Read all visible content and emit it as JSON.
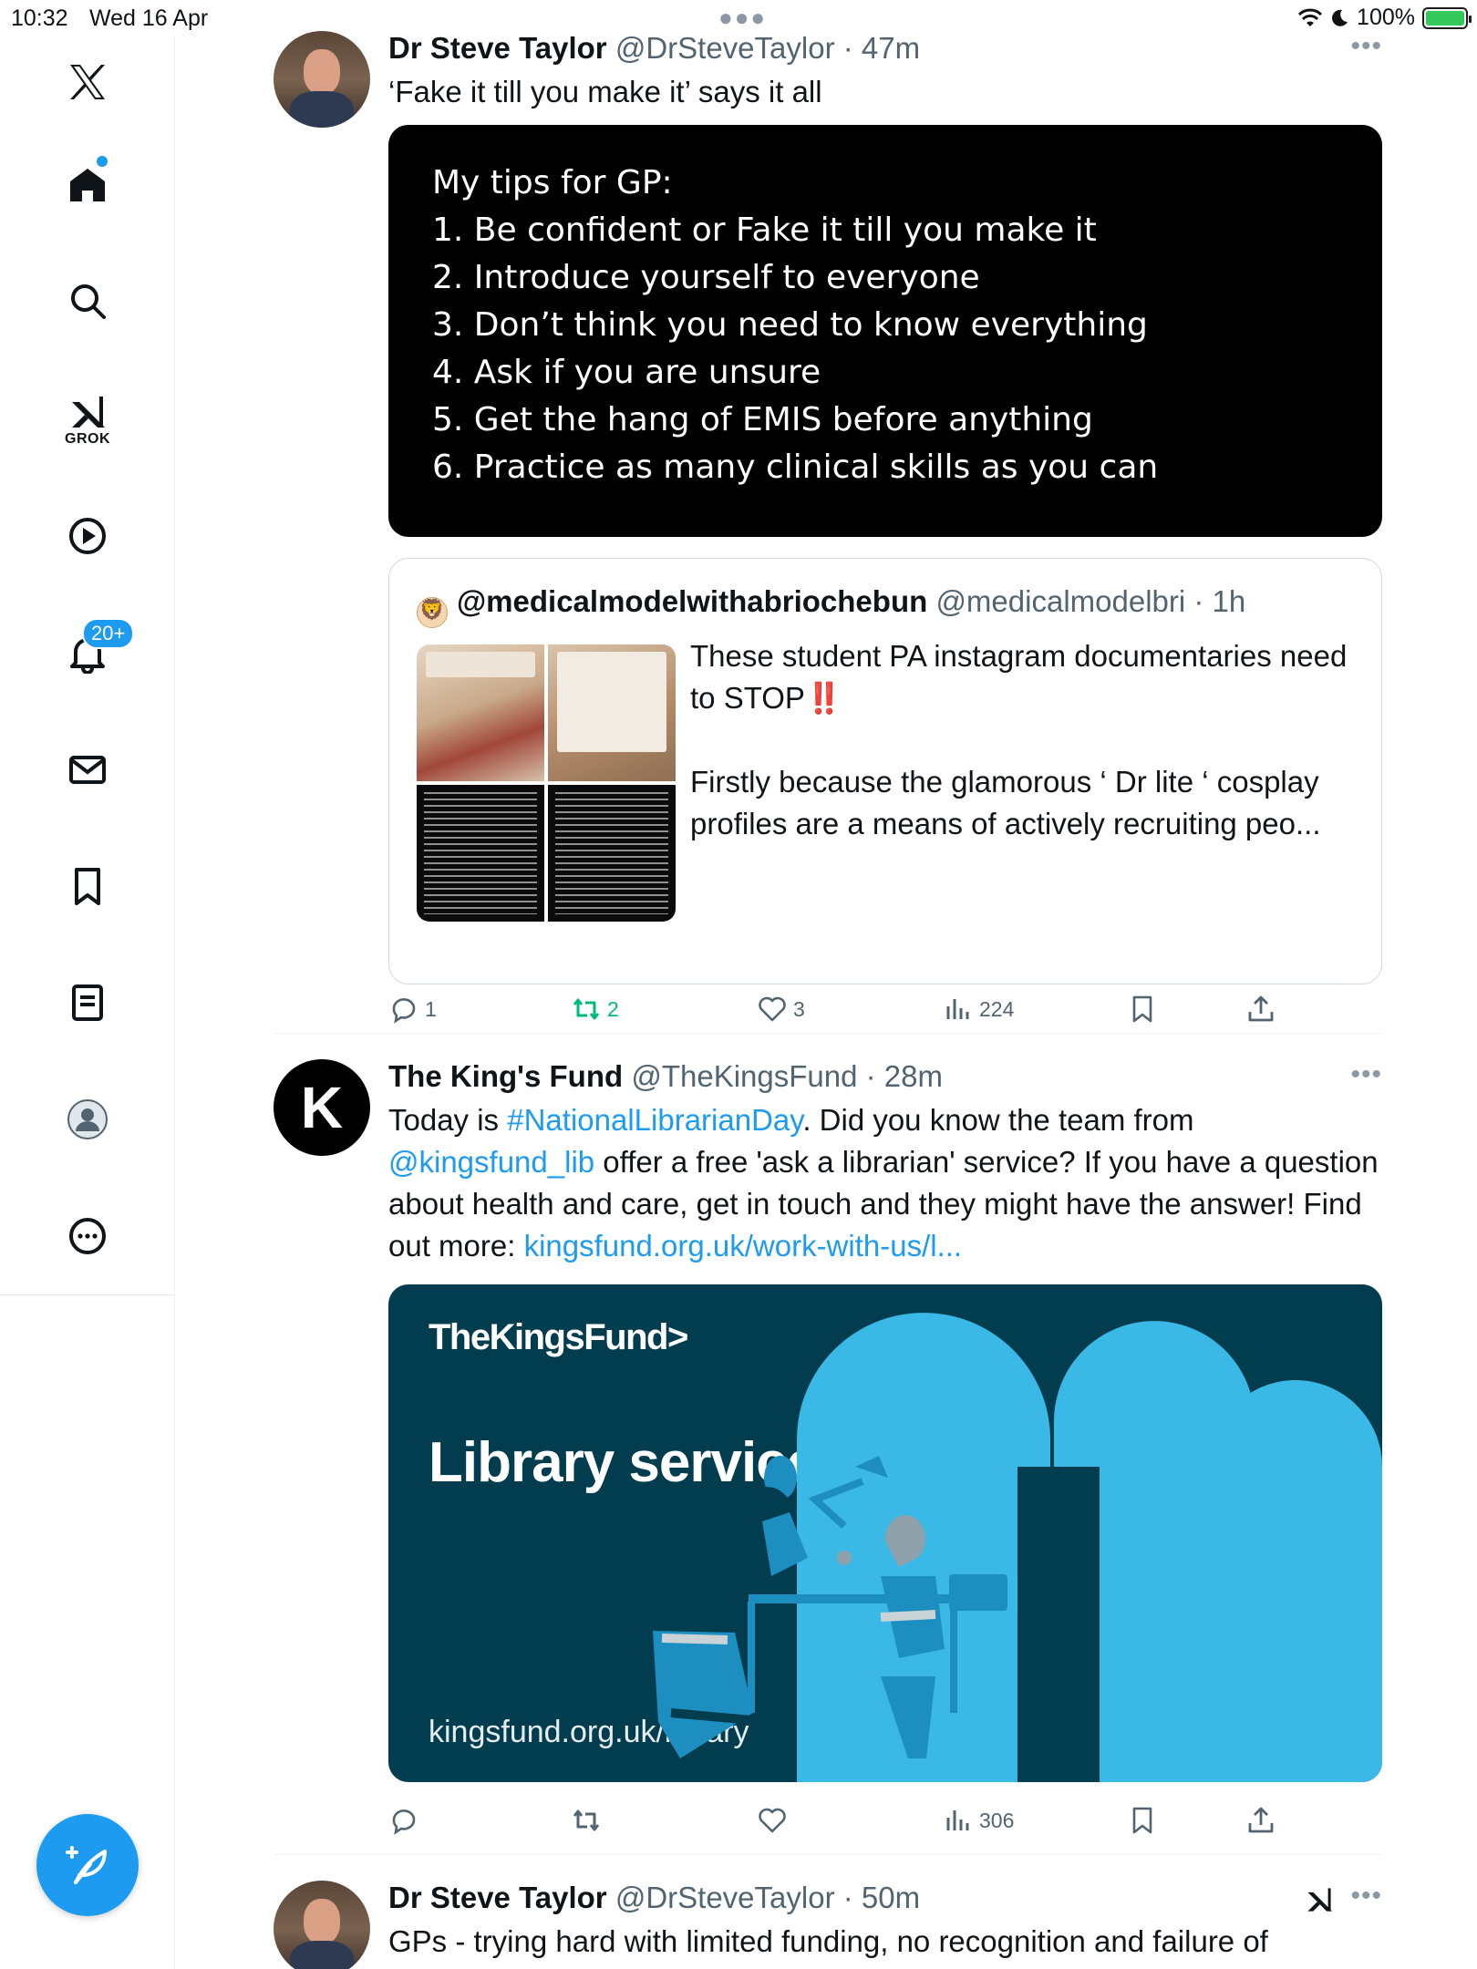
{
  "status_bar": {
    "time": "10:32",
    "date": "Wed 16 Apr",
    "battery": "100%",
    "battery_level": 1.0
  },
  "sidebar": {
    "items": [
      {
        "icon": "x-logo-icon"
      },
      {
        "icon": "home-icon"
      },
      {
        "icon": "search-icon"
      },
      {
        "icon": "grok-icon",
        "label": "GROK"
      },
      {
        "icon": "video-icon"
      },
      {
        "icon": "bell-icon",
        "badge": "20+"
      },
      {
        "icon": "mail-icon"
      },
      {
        "icon": "bookmark-icon"
      },
      {
        "icon": "lists-icon"
      },
      {
        "icon": "profile-icon"
      },
      {
        "icon": "more-icon"
      }
    ],
    "compose_icon": "compose-feather-icon"
  },
  "tweets": [
    {
      "name": "Dr Steve Taylor",
      "handle": "@DrSteveTaylor",
      "time": "47m",
      "text": "‘Fake it till you make it’ says it all",
      "image_lines": [
        "My tips for GP:",
        "1. Be confident or Fake it till you make it",
        "2. Introduce yourself to everyone",
        "3. Don’t think you need to know everything",
        "4. Ask if you are unsure",
        "5. Get the hang of EMIS before anything",
        "6. Practice as many clinical skills as you can"
      ],
      "quote": {
        "name": "@medicalmodelwithabriochebun",
        "handle": "@medicalmodelbri",
        "time": "1h",
        "text_1": "These student PA instagram documentaries need to STOP",
        "emoji": "‼️",
        "text_2": "Firstly because the glamorous ‘ Dr lite ‘ cosplay profiles are a means of actively recruiting peo..."
      },
      "stats": {
        "replies": "1",
        "reposts": "2",
        "likes": "3",
        "views": "224"
      }
    },
    {
      "name": "The King's Fund",
      "handle": "@TheKingsFund",
      "time": "28m",
      "avatar_letter": "K",
      "text_1": "Today is ",
      "hashtag": "#NationalLibrarianDay",
      "text_2": ". Did you know the team from ",
      "mention": "@kingsfund_lib",
      "text_3": " offer a  free 'ask a librarian' service? If you have a question about health and care, get in touch and they might have the answer! Find out more: ",
      "url": "kingsfund.org.uk/work-with-us/l...",
      "card": {
        "logo": "TheKingsFund>",
        "title": "Library services",
        "url": "kingsfund.org.uk/library"
      },
      "stats": {
        "replies": "",
        "reposts": "",
        "likes": "",
        "views": "306"
      }
    },
    {
      "name": "Dr Steve Taylor",
      "handle": "@DrSteveTaylor",
      "time": "50m",
      "text": "GPs - trying hard with limited funding, no recognition and failure of"
    }
  ]
}
